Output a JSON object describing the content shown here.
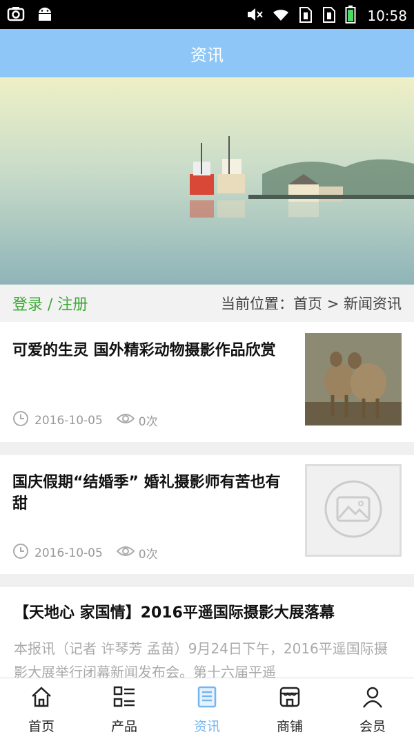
{
  "status_bar": {
    "time": "10:58"
  },
  "header": {
    "title": "资讯"
  },
  "location_bar": {
    "login_label": "登录 / 注册",
    "breadcrumb": "当前位置：首页 > 新闻资讯"
  },
  "news": [
    {
      "title": "可爱的生灵 国外精彩动物摄影作品欣赏",
      "date": "2016-10-05",
      "views": "0次"
    },
    {
      "title": "国庆假期“结婚季” 婚礼摄影师有苦也有甜",
      "date": "2016-10-05",
      "views": "0次"
    },
    {
      "title": "【天地心 家国情】2016平遥国际摄影大展落幕",
      "summary": "本报讯（记者 许琴芳 孟苗）9月24日下午，2016平遥国际摄影大展举行闭幕新闻发布会。第十六届平遥"
    }
  ],
  "bottom_nav": {
    "active_color": "#74b6f0",
    "items": [
      {
        "label": "首页",
        "icon": "home-icon"
      },
      {
        "label": "产品",
        "icon": "list-icon"
      },
      {
        "label": "资讯",
        "icon": "news-icon"
      },
      {
        "label": "商铺",
        "icon": "shop-icon"
      },
      {
        "label": "会员",
        "icon": "user-icon"
      }
    ]
  },
  "colors": {
    "header_bg": "#8ec7f7",
    "login_green": "#3fa936"
  }
}
